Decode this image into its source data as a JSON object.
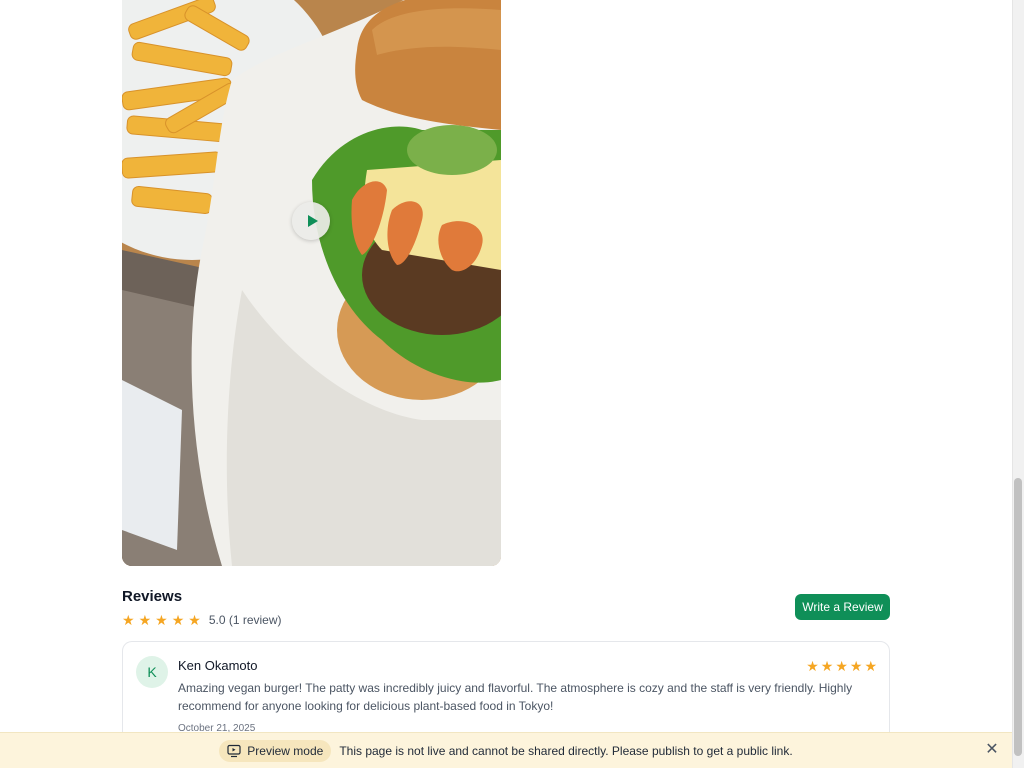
{
  "reviews": {
    "title": "Reviews",
    "average_rating": 5.0,
    "rating_summary": "5.0 (1 review)",
    "write_button": "Write a Review",
    "items": [
      {
        "avatar_initial": "K",
        "author": "Ken Okamoto",
        "rating": 5,
        "text": "Amazing vegan burger! The patty was incredibly juicy and flavorful. The atmosphere is cozy and the staff is very friendly. Highly recommend for anyone looking for delicious plant-based food in Tokyo!",
        "date": "October 21, 2025"
      }
    ]
  },
  "media": {
    "icon": "play-icon"
  },
  "banner": {
    "mode_label": "Preview mode",
    "message": "This page is not live and cannot be shared directly. Please publish to get a public link.",
    "icon": "monitor-icon",
    "close_icon": "close-icon"
  },
  "colors": {
    "accent": "#0f8f58",
    "star": "#f5a623",
    "banner_bg": "#fdf4dc"
  }
}
